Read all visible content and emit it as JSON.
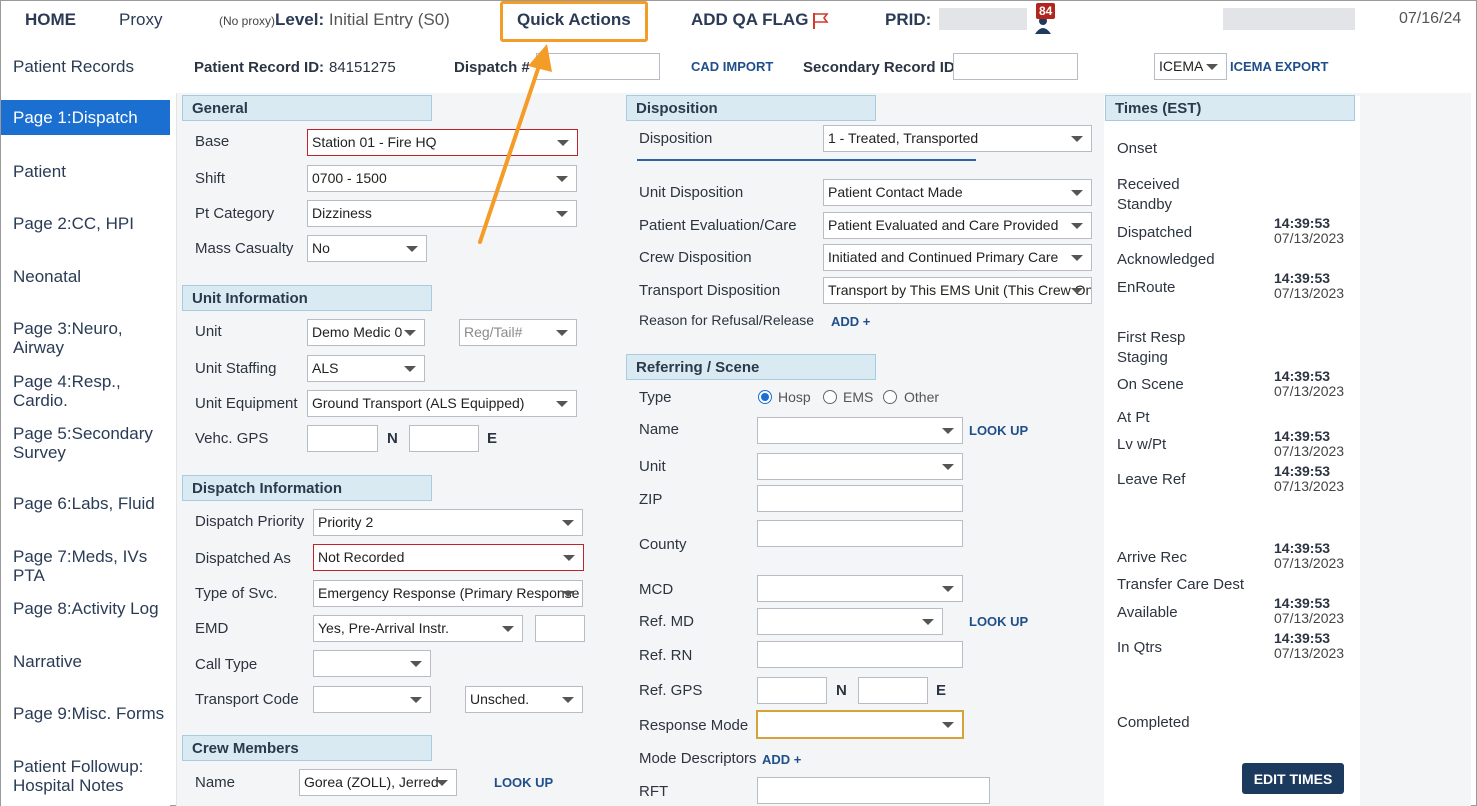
{
  "topbar": {
    "home": "HOME",
    "proxy": "Proxy",
    "no_proxy": "(No proxy)",
    "level_label": "Level:",
    "level_value": "Initial Entry (S0)",
    "quick_actions": "Quick Actions",
    "add_qa_flag": "ADD QA FLAG",
    "prid_label": "PRID:",
    "notif_count": "84",
    "date": "07/16/24"
  },
  "nav": {
    "items": [
      {
        "prefix": "",
        "label": "Patient Records"
      },
      {
        "prefix": "Page 1:",
        "label": "Dispatch"
      },
      {
        "prefix": "",
        "label": "Patient"
      },
      {
        "prefix": "Page 2:",
        "label": "CC, HPI"
      },
      {
        "prefix": "",
        "label": "Neonatal"
      },
      {
        "prefix": "Page 3:",
        "label": "Neuro, Airway"
      },
      {
        "prefix": "Page 4:",
        "label": "Resp., Cardio."
      },
      {
        "prefix": "Page 5:",
        "label": "Secondary",
        "label2": "Survey"
      },
      {
        "prefix": "Page 6:",
        "label": "Labs, Fluid"
      },
      {
        "prefix": "Page 7:",
        "label": "Meds, IVs PTA"
      },
      {
        "prefix": "Page 8:",
        "label": "Activity Log"
      },
      {
        "prefix": "",
        "label": "Narrative"
      },
      {
        "prefix": "Page 9:",
        "label": "Misc. Forms"
      },
      {
        "prefix": "",
        "label": "Patient Followup:",
        "label2": "Hospital Notes"
      }
    ]
  },
  "header": {
    "patient_record_id_label": "Patient Record ID:",
    "patient_record_id": "84151275",
    "dispatch_label": "Dispatch #",
    "cad_import": "CAD IMPORT",
    "secondary_record_label": "Secondary Record ID",
    "icema_select": "ICEMA",
    "icema_export": "ICEMA EXPORT"
  },
  "general": {
    "title": "General",
    "base_label": "Base",
    "base_value": "Station 01 - Fire HQ",
    "shift_label": "Shift",
    "shift_value": "0700 - 1500",
    "ptcat_label": "Pt Category",
    "ptcat_value": "Dizziness",
    "mass_label": "Mass Casualty",
    "mass_value": "No"
  },
  "unit": {
    "title": "Unit Information",
    "unit_label": "Unit",
    "unit_value": "Demo Medic 0",
    "reg_placeholder": "Reg/Tail#",
    "staffing_label": "Unit Staffing",
    "staffing_value": "ALS",
    "equipment_label": "Unit Equipment",
    "equipment_value": "Ground Transport (ALS Equipped)",
    "gps_label": "Vehc. GPS",
    "n": "N",
    "e": "E"
  },
  "dispatch_info": {
    "title": "Dispatch Information",
    "priority_label": "Dispatch Priority",
    "priority_value": "Priority 2",
    "dispatched_as_label": "Dispatched As",
    "dispatched_as_value": "Not Recorded",
    "svc_label": "Type of Svc.",
    "svc_value": "Emergency Response (Primary Response Area)",
    "emd_label": "EMD",
    "emd_value": "Yes, Pre-Arrival Instr.",
    "call_type_label": "Call Type",
    "transport_code_label": "Transport Code",
    "transport_code_value": "Unsched."
  },
  "crew": {
    "title": "Crew Members",
    "name_label": "Name",
    "name_value": "Gorea (ZOLL), Jerred",
    "look_up": "LOOK UP"
  },
  "disposition": {
    "title": "Disposition",
    "disp_label": "Disposition",
    "disp_value": "1 - Treated, Transported",
    "unit_disp_label": "Unit Disposition",
    "unit_disp_value": "Patient Contact Made",
    "eval_label": "Patient Evaluation/Care",
    "eval_value": "Patient Evaluated and Care Provided",
    "crew_disp_label": "Crew Disposition",
    "crew_disp_value": "Initiated and Continued Primary Care",
    "transport_disp_label": "Transport Disposition",
    "transport_disp_value": "Transport by This EMS Unit (This Crew Only)",
    "refusal_label": "Reason for Refusal/Release",
    "add": "ADD +"
  },
  "referring": {
    "title": "Referring / Scene",
    "type_label": "Type",
    "opt_hosp": "Hosp",
    "opt_ems": "EMS",
    "opt_other": "Other",
    "name_label": "Name",
    "look_up": "LOOK UP",
    "unit_label": "Unit",
    "zip_label": "ZIP",
    "county_label": "County",
    "mcd_label": "MCD",
    "refmd_label": "Ref. MD",
    "look_up2": "LOOK UP",
    "refrn_label": "Ref. RN",
    "refgps_label": "Ref. GPS",
    "n": "N",
    "e": "E",
    "response_mode_label": "Response Mode",
    "mode_desc_label": "Mode Descriptors",
    "add": "ADD +",
    "rft_label": "RFT"
  },
  "times": {
    "title": "Times (EST)",
    "rows": [
      {
        "label": "Onset",
        "time": "",
        "date": ""
      },
      {
        "label": "Received",
        "time": "",
        "date": ""
      },
      {
        "label": "Standby",
        "time": "",
        "date": ""
      },
      {
        "label": "Dispatched",
        "time": "14:39:53",
        "date": "07/13/2023"
      },
      {
        "label": "Acknowledged",
        "time": "",
        "date": ""
      },
      {
        "label": "EnRoute",
        "time": "14:39:53",
        "date": "07/13/2023"
      },
      {
        "label": "First Resp",
        "time": "",
        "date": ""
      },
      {
        "label": "Staging",
        "time": "",
        "date": ""
      },
      {
        "label": "On Scene",
        "time": "14:39:53",
        "date": "07/13/2023"
      },
      {
        "label": "At Pt",
        "time": "",
        "date": ""
      },
      {
        "label": "Lv w/Pt",
        "time": "14:39:53",
        "date": "07/13/2023"
      },
      {
        "label": "Leave Ref",
        "time": "14:39:53",
        "date": "07/13/2023"
      },
      {
        "label": "Arrive Rec",
        "time": "14:39:53",
        "date": "07/13/2023"
      },
      {
        "label": "Transfer Care Dest",
        "time": "",
        "date": ""
      },
      {
        "label": "Available",
        "time": "14:39:53",
        "date": "07/13/2023"
      },
      {
        "label": "In Qtrs",
        "time": "14:39:53",
        "date": "07/13/2023"
      },
      {
        "label": "Completed",
        "time": "",
        "date": ""
      }
    ],
    "edit_times": "EDIT TIMES"
  },
  "colors": {
    "nav_active": "#1b6fd0",
    "section_header": "#daeaf3",
    "highlight": "#f39c28",
    "required_border": "#c0232c",
    "edit_button": "#1c3a5e"
  }
}
